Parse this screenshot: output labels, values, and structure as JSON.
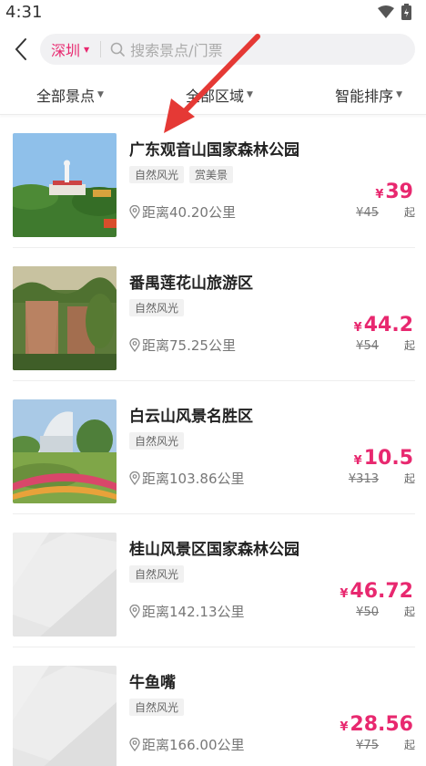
{
  "status": {
    "time": "4:31"
  },
  "header": {
    "city": "深圳",
    "search_placeholder": "搜索景点/门票"
  },
  "filters": [
    {
      "label": "全部景点"
    },
    {
      "label": "全部区域"
    },
    {
      "label": "智能排序"
    }
  ],
  "items": [
    {
      "title": "广东观音山国家森林公园",
      "tags": [
        "自然风光",
        "赏美景"
      ],
      "price": "39",
      "orig": "45",
      "distance": "距离40.20公里",
      "image": "guanyin-mountain"
    },
    {
      "title": "番禺莲花山旅游区",
      "tags": [
        "自然风光"
      ],
      "price": "44.2",
      "orig": "54",
      "distance": "距离75.25公里",
      "image": "lotus-mountain"
    },
    {
      "title": "白云山风景名胜区",
      "tags": [
        "自然风光"
      ],
      "price": "10.5",
      "orig": "313",
      "distance": "距离103.86公里",
      "image": "baiyun-mountain"
    },
    {
      "title": "桂山风景区国家森林公园",
      "tags": [
        "自然风光"
      ],
      "price": "46.72",
      "orig": "50",
      "distance": "距离142.13公里",
      "image": "placeholder"
    },
    {
      "title": "牛鱼嘴",
      "tags": [
        "自然风光"
      ],
      "price": "28.56",
      "orig": "75",
      "distance": "距离166.00公里",
      "image": "placeholder"
    }
  ],
  "labels": {
    "yen": "¥",
    "qi": "起"
  },
  "colors": {
    "accent": "#e8286f",
    "arrow": "#e53935"
  }
}
